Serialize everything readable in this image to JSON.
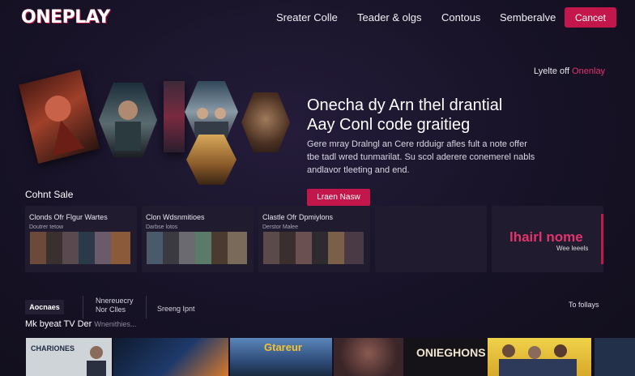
{
  "header": {
    "logo": "ONEPLAY",
    "nav": [
      "Sreater Colle",
      "Teader & olgs",
      "Contous",
      "Semberalve"
    ],
    "cta_label": "Cancet"
  },
  "hero": {
    "tagline_prefix": "Lyelte off",
    "tagline_accent": "Onenlay",
    "title_line1": "Onecha dy Arn thel drantial",
    "title_line2": "Aay Conl code graitieg",
    "desc_line1": "Gere mray Dralngl an Cere rdduigr afles fult a note offer",
    "desc_line2": "tbe tadl wred tunmarilat. Su scol aderere conemerel nabls",
    "desc_line3": "andlavor tleeting and end.",
    "button_label": "Lraen Nasw"
  },
  "collections": {
    "title": "Cohnt Sale",
    "cards": [
      {
        "title": "Clonds Ofr Flgur Wartes",
        "sub": "Doutrer tetow"
      },
      {
        "title": "Clon Wdsnmitioes",
        "sub": "Darbse lotos"
      },
      {
        "title": "Clastle Ofr Dpmiylons",
        "sub": "Derstor Malee"
      }
    ],
    "promo": {
      "title": "lhairl nome",
      "sub": "Wee leeels"
    }
  },
  "tabs": {
    "active": "Aocnaes",
    "second_line1": "Nnereuecry",
    "second_line2": "Nor Clles",
    "third": "Sreeng Ipnt",
    "see_all": "To follays"
  },
  "tv_section": {
    "title": "Mk byeat TV Der",
    "sub": "Wnenithies..."
  },
  "bottom_posters": [
    {
      "title": "CHARIONES",
      "bg": "#cfd4d9"
    },
    {
      "title": "",
      "bg": "#0f1a2e"
    },
    {
      "title": "Gtareur",
      "bg": "#2f4d7a"
    },
    {
      "title": "",
      "bg": "#3a2528"
    },
    {
      "title": "ONIEGHONS",
      "bg": "#151218"
    },
    {
      "title": "",
      "bg": "#e6c43a"
    },
    {
      "title": "",
      "bg": "#22304a"
    }
  ],
  "colors": {
    "accent": "#c3174b",
    "background": "#13101f",
    "promo_text": "#e2336c"
  }
}
